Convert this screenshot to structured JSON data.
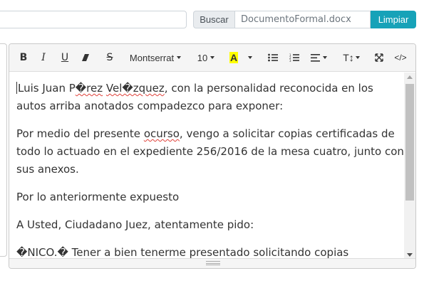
{
  "search": {
    "label": "Buscar",
    "value": "DocumentoFormal.docx",
    "clear_label": "Limpiar"
  },
  "toolbar": {
    "bold": "B",
    "italic": "I",
    "underline": "U",
    "strikethrough": "S",
    "font_family": "Montserrat",
    "font_size": "10",
    "font_color_letter": "A",
    "font_color_swatch": "#ffff00",
    "line_height_label": "T↕",
    "code_view": "</>"
  },
  "icons": [
    "eraser-icon",
    "text-color-icon",
    "unordered-list-icon",
    "ordered-list-icon",
    "align-icon",
    "fullscreen-icon",
    "code-view-icon"
  ],
  "document": {
    "p1": {
      "t1": "Luis Juan P",
      "err1": "�rez",
      "t2": " ",
      "err2": "Vel�zquez",
      "t3": ", con la personalidad reconocida en los autos arriba anotados compadezco para exponer:"
    },
    "p2": {
      "t1": "Por medio del presente ",
      "err1": "ocurso",
      "t2": ", vengo a solicitar copias certificadas de todo lo actuado en el expediente 256/2016 de la mesa cuatro, junto con sus anexos."
    },
    "p3": "Por lo anteriormente expuesto",
    "p4": "A Usted, Ciudadano Juez, atentamente pido:",
    "p5": {
      "t1": "�",
      "err1": "NICO",
      "t2": ".� Tener a bien tenerme presentado solicitando copias certificadas de todo lo actuado."
    }
  }
}
